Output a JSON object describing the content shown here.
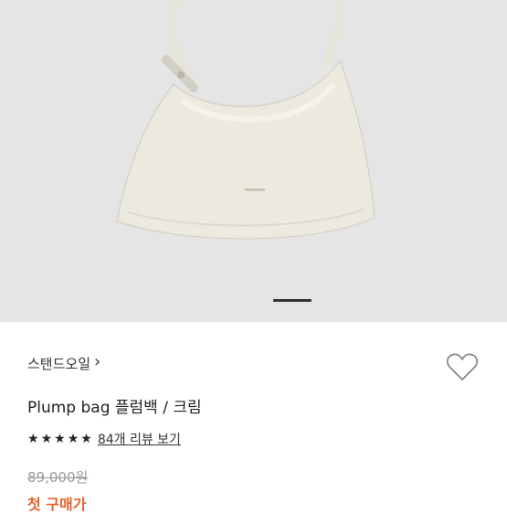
{
  "product": {
    "brand": "스탠드오일",
    "brand_chevron": "›",
    "name": "Plump bag 플럼백 / 크림",
    "rating_stars": 5,
    "star_glyph": "★",
    "review_link": "84개 리뷰 보기",
    "original_price": "89,000원",
    "first_purchase_label": "첫 구매가"
  },
  "gallery": {
    "pager_icon": "pager-indicator",
    "image_icon": "product-bag-image"
  },
  "icons": {
    "wishlist": "heart-icon"
  },
  "colors": {
    "hero_background": "#e5e5e5",
    "bag": "#ece9df",
    "accent": "#e8612c",
    "text": "#222222",
    "muted": "#999999"
  }
}
